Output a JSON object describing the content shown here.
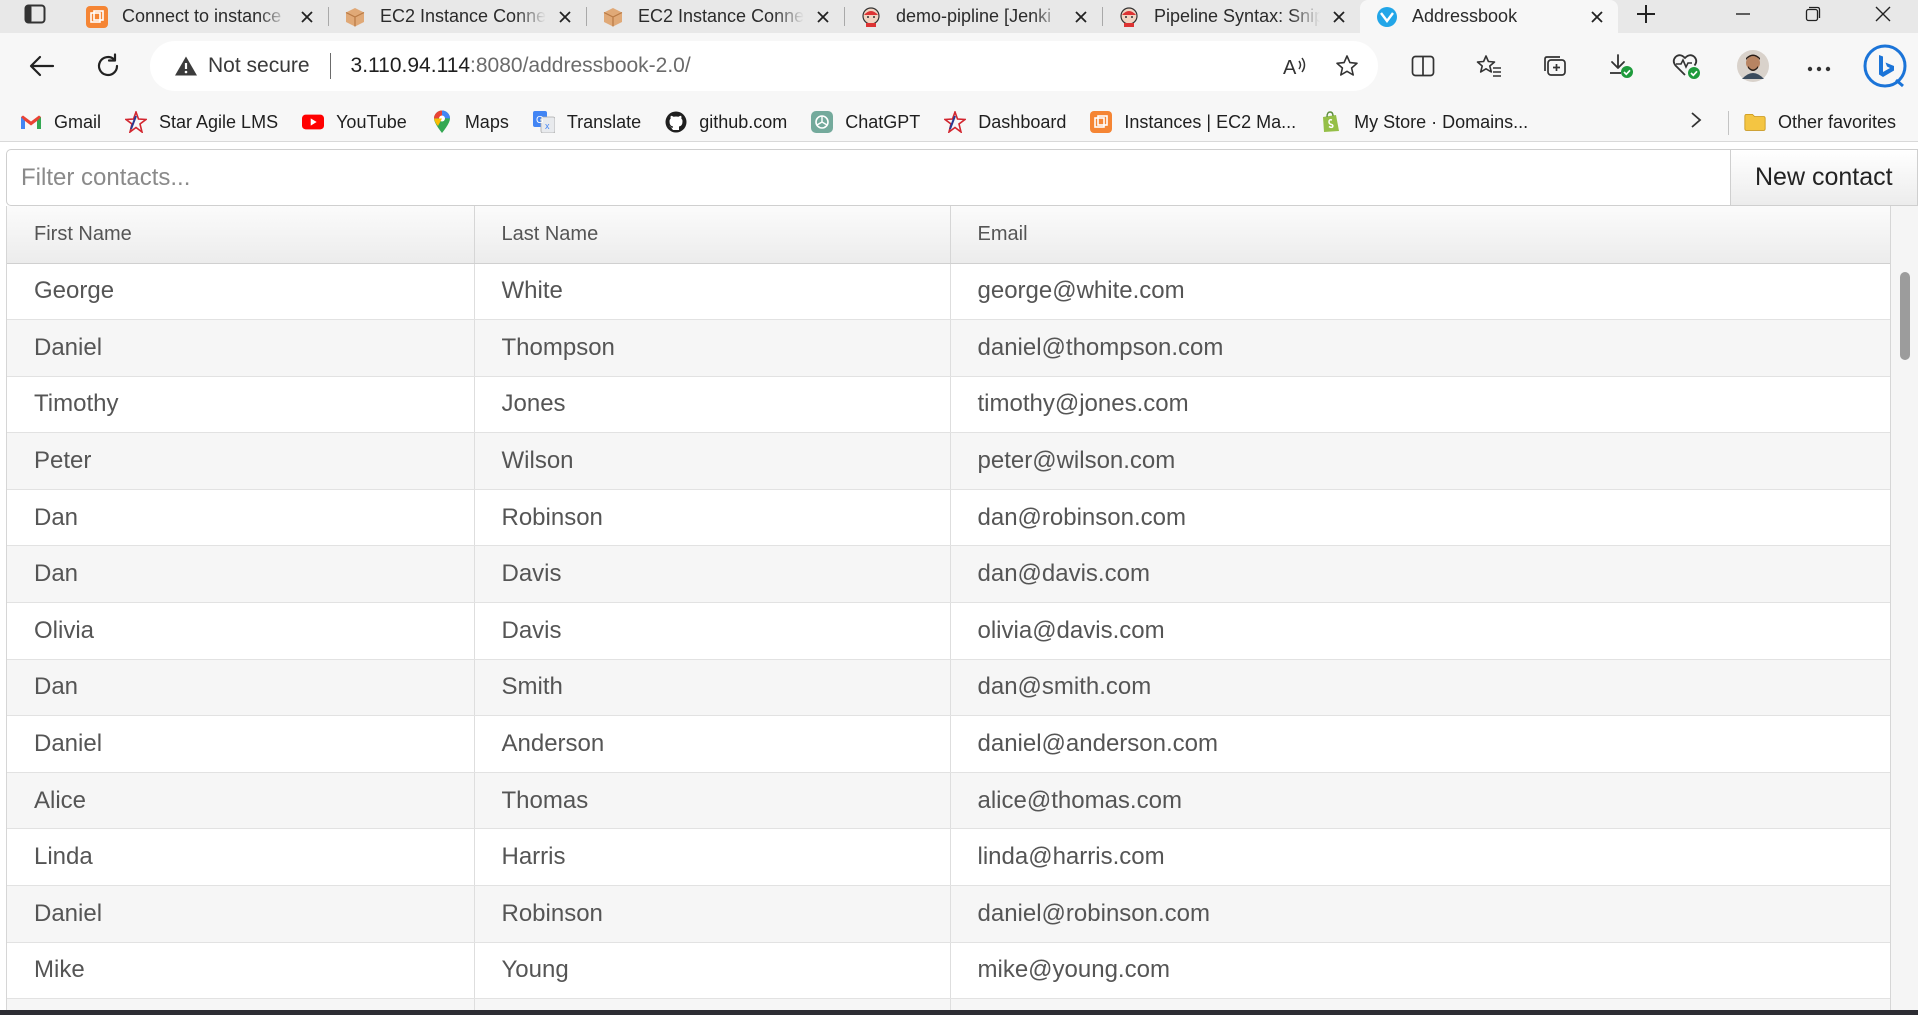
{
  "tabs": [
    {
      "title": "Connect to instance",
      "favicon": "aws-console-icon",
      "color": "#f58534"
    },
    {
      "title": "EC2 Instance Conne",
      "favicon": "aws-box-icon",
      "color": "#d9a06b"
    },
    {
      "title": "EC2 Instance Conne",
      "favicon": "aws-box-icon",
      "color": "#d9a06b"
    },
    {
      "title": "demo-pipline [Jenki",
      "favicon": "jenkins-icon",
      "color": "#c33"
    },
    {
      "title": "Pipeline Syntax: Snip",
      "favicon": "jenkins-icon",
      "color": "#c33"
    },
    {
      "title": "Addressbook",
      "favicon": "vaadin-icon",
      "color": "#22a6e8",
      "active": true
    }
  ],
  "address_bar": {
    "security_label": "Not secure",
    "url_host": "3.110.94.114",
    "url_rest": ":8080/addressbook-2.0/"
  },
  "bookmarks": [
    {
      "label": "Gmail",
      "icon": "gmail-icon"
    },
    {
      "label": "Star Agile LMS",
      "icon": "star-agile-icon"
    },
    {
      "label": "YouTube",
      "icon": "youtube-icon"
    },
    {
      "label": "Maps",
      "icon": "maps-pin-icon"
    },
    {
      "label": "Translate",
      "icon": "translate-icon"
    },
    {
      "label": "github.com",
      "icon": "github-icon"
    },
    {
      "label": "ChatGPT",
      "icon": "chatgpt-icon"
    },
    {
      "label": "Dashboard",
      "icon": "star-agile-icon"
    },
    {
      "label": "Instances | EC2 Ma...",
      "icon": "aws-console-icon"
    },
    {
      "label": "My Store · Domains...",
      "icon": "shopify-icon"
    }
  ],
  "other_favorites": "Other favorites",
  "filter": {
    "placeholder": "Filter contacts..."
  },
  "new_contact_label": "New contact",
  "table": {
    "columns": [
      "First Name",
      "Last Name",
      "Email"
    ],
    "rows": [
      [
        "George",
        "White",
        "george@white.com"
      ],
      [
        "Daniel",
        "Thompson",
        "daniel@thompson.com"
      ],
      [
        "Timothy",
        "Jones",
        "timothy@jones.com"
      ],
      [
        "Peter",
        "Wilson",
        "peter@wilson.com"
      ],
      [
        "Dan",
        "Robinson",
        "dan@robinson.com"
      ],
      [
        "Dan",
        "Davis",
        "dan@davis.com"
      ],
      [
        "Olivia",
        "Davis",
        "olivia@davis.com"
      ],
      [
        "Dan",
        "Smith",
        "dan@smith.com"
      ],
      [
        "Daniel",
        "Anderson",
        "daniel@anderson.com"
      ],
      [
        "Alice",
        "Thomas",
        "alice@thomas.com"
      ],
      [
        "Linda",
        "Harris",
        "linda@harris.com"
      ],
      [
        "Daniel",
        "Robinson",
        "daniel@robinson.com"
      ],
      [
        "Mike",
        "Young",
        "mike@young.com"
      ],
      [
        "",
        "",
        ""
      ]
    ]
  }
}
